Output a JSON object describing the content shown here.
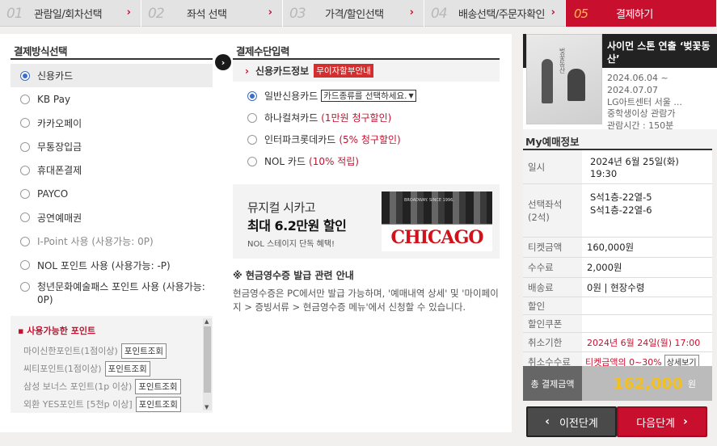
{
  "steps": [
    {
      "num": "01",
      "label": "관람일/회차선택"
    },
    {
      "num": "02",
      "label": "좌석 선택"
    },
    {
      "num": "03",
      "label": "가격/할인선택"
    },
    {
      "num": "04",
      "label": "배송선택/주문자확인"
    },
    {
      "num": "05",
      "label": "결제하기"
    }
  ],
  "method": {
    "title": "결제방식선택",
    "options": [
      "신용카드",
      "KB Pay",
      "카카오페이",
      "무통장입금",
      "휴대폰결제",
      "PAYCO",
      "공연예매권",
      "I-Point 사용 (사용가능: 0P)",
      "NOL 포인트 사용 (사용가능: -P)",
      "청년문화예술패스 포인트 사용 (사용가능: 0P)"
    ],
    "points_title": "사용가능한 포인트",
    "points": [
      {
        "label": "마이신한포인트(1점이상)",
        "btn": "포인트조회"
      },
      {
        "label": "씨티포인트(1점이상)",
        "btn": "포인트조회"
      },
      {
        "label": "삼성 보너스 포인트(1p 이상)",
        "btn": "포인트조회"
      },
      {
        "label": "외환 YES포인트 [5천p 이상]",
        "btn": "포인트조회"
      }
    ]
  },
  "means": {
    "title": "결제수단입력",
    "card_title": "신용카드정보",
    "badge": "무이자할부안내",
    "card_options": [
      {
        "label": "일반신용카드",
        "select": "카드종류를 선택하세요.",
        "note": ""
      },
      {
        "label": "하나컬쳐카드",
        "select": "",
        "note": "(1만원 청구할인)"
      },
      {
        "label": "인터파크롯데카드",
        "select": "",
        "note": "(5% 청구할인)"
      },
      {
        "label": "NOL 카드",
        "select": "",
        "note": "(10% 적립)"
      }
    ],
    "banner": {
      "line1": "뮤지컬 시카고",
      "line2": "최대 6.2만원 할인",
      "line3": "NOL 스테이지 단독 혜택!",
      "brand": "CHICAGO",
      "brand_sub": "BROADWAY. SINCE 1996."
    },
    "note_title": "※ 현금영수증 발급 관련 안내",
    "note_body": "현금영수증은 PC에서만 발급 가능하며, '예매내역 상세' 및 '마이페이지 > 증빙서류 > 현금영수증 메뉴'에서 신청할 수 있습니다."
  },
  "show": {
    "title": "사이먼 스톤 연출 ‘벚꽃동산’",
    "poster_text": "벚꽃동산",
    "date_from": "2024.06.04 ~",
    "date_to": "2024.07.07",
    "venue": "LG아트센터 서울 ...",
    "age": "중학생이상 관람가",
    "runtime": "관람시간 : 150분"
  },
  "my": {
    "title": "My예매정보",
    "rows": [
      {
        "k": "일시",
        "v": "2024년 6월 25일(화)",
        "v2": "19:30"
      },
      {
        "k": "선택좌석",
        "k2": "(2석)",
        "v": "S석1층-22열-5",
        "v2": "S석1층-22열-6"
      },
      {
        "k": "티켓금액",
        "v": "160,000원"
      },
      {
        "k": "수수료",
        "v": "2,000원"
      },
      {
        "k": "배송료",
        "v": "0원 | 현장수령"
      },
      {
        "k": "할인",
        "v": ""
      },
      {
        "k": "할인쿠폰",
        "v": ""
      },
      {
        "k": "취소기한",
        "v": "2024년 6월 24일(월) 17:00"
      },
      {
        "k": "취소수수료",
        "v": "티켓금액의 0~30%",
        "btn": "상세보기"
      }
    ],
    "total_label": "총 결제금액",
    "total": "162,000",
    "won": "원"
  },
  "nav": {
    "prev": "이전단계",
    "next": "다음단계"
  }
}
